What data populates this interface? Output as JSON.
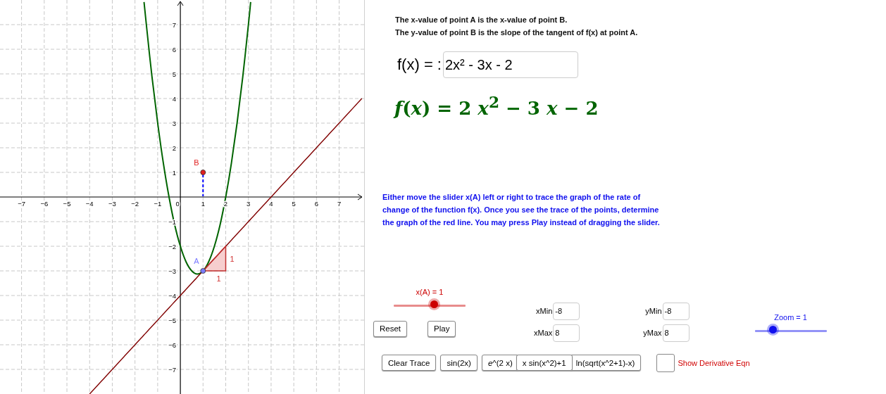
{
  "graph": {
    "chart_data": {
      "type": "line",
      "x": [
        -4,
        -3.75,
        -3.5,
        -3.25,
        -3,
        -2.75,
        -2.5,
        -2.25,
        -2,
        -1.75,
        -1.6,
        -1.5,
        -1.25,
        -1,
        -0.75,
        -0.5,
        -0.25,
        0,
        0.25,
        0.5,
        0.75,
        1,
        1.25,
        1.5,
        1.75,
        2,
        2.25,
        2.5,
        2.75,
        3,
        3.1,
        3.25,
        3.5,
        3.75,
        4,
        4.25,
        4.5,
        4.75,
        5,
        5.25,
        5.5,
        5.75,
        6,
        6.25,
        6.5,
        6.75,
        7,
        7.25,
        7.5,
        7.75,
        8
      ],
      "series": [
        {
          "color": "#006400",
          "values": [
            null,
            null,
            null,
            null,
            null,
            null,
            null,
            null,
            null,
            null,
            7.92,
            7,
            4.88,
            3,
            1.38,
            0,
            -1.13,
            -2,
            -2.63,
            -3,
            -3.13,
            -3,
            -2.63,
            -2,
            -1.13,
            0,
            1.38,
            3,
            4.88,
            7,
            7.92,
            null,
            null,
            null,
            null,
            null,
            null,
            null,
            null,
            null,
            null,
            null,
            null,
            null,
            null,
            null,
            null,
            null,
            null,
            null,
            null
          ]
        },
        {
          "color": "#800000",
          "values": [
            -8,
            -7.75,
            -7.5,
            -7.25,
            -7,
            -6.75,
            -6.5,
            -6.25,
            -6,
            -5.75,
            -5.6,
            -5.5,
            -5.25,
            -5,
            -4.75,
            -4.5,
            -4.25,
            -4,
            -3.75,
            -3.5,
            -3.25,
            -3,
            -2.75,
            -2.5,
            -2.25,
            -2,
            -1.75,
            -1.5,
            -1.25,
            -1,
            -0.9,
            -0.75,
            -0.5,
            -0.25,
            0,
            0.25,
            0.5,
            0.75,
            1,
            1.25,
            1.5,
            1.75,
            2,
            2.25,
            2.5,
            2.75,
            3,
            3.25,
            3.5,
            3.75,
            4
          ]
        }
      ],
      "grid": true,
      "xlim": [
        -7.95,
        8.1
      ],
      "ylim": [
        -8,
        8
      ],
      "xticks": [
        {
          "value": -7,
          "label": "−7"
        },
        {
          "value": -6,
          "label": "−6"
        },
        {
          "value": -5,
          "label": "−5"
        },
        {
          "value": -4,
          "label": "−4"
        },
        {
          "value": -3,
          "label": "−3"
        },
        {
          "value": -2,
          "label": "−2"
        },
        {
          "value": -1,
          "label": "−1"
        },
        0,
        1,
        2,
        3,
        4,
        5,
        6,
        7
      ],
      "yticks": [
        {
          "value": -7,
          "label": "−7"
        },
        {
          "value": -6,
          "label": "−6"
        },
        {
          "value": -5,
          "label": "−5"
        },
        {
          "value": -4,
          "label": "−4"
        },
        {
          "value": -3,
          "label": "−3"
        },
        {
          "value": -2,
          "label": "−2"
        },
        {
          "value": -1,
          "label": "−1"
        },
        1,
        2,
        3,
        4,
        5,
        6,
        7
      ]
    },
    "slope_triangle": {
      "run_label": "1",
      "rise_label": "1"
    },
    "points": [
      {
        "label": "B",
        "color": "#e02020"
      },
      {
        "label": "A",
        "color": "#7b7bff"
      }
    ]
  },
  "instructions": [
    "The x-value of point A is the x-value of point B.",
    "The y-value of point B is the slope of the tangent of f(x) at point A."
  ],
  "function_input": {
    "label": "f(x) = :",
    "value": "2x² - 3x - 2"
  },
  "formula": "*f*(*x*) = 2 *x*$^{2}$ − 3 *x* − 2",
  "hint": "Either move the slider x(A) left or right to trace the graph of the rate of change of the function f(x). Once you see the trace of the points, determine the graph of the red line. You may press Play instead of dragging the slider.",
  "slider_x": {
    "label": "x(A) = 1",
    "level": 0.57
  },
  "play_buttons": [
    "Reset",
    "Play"
  ],
  "range_fields": [
    {
      "label": "xMin",
      "value": "-8"
    },
    {
      "label": "xMax",
      "value": "8"
    },
    {
      "label": "yMin",
      "value": "-8"
    },
    {
      "label": "yMax",
      "value": "8"
    }
  ],
  "zoom_slider": {
    "label": "Zoom = 1",
    "level": 0.26
  },
  "function_buttons": [
    "Clear Trace",
    "sin(2x)",
    "*e*^(2 x)",
    "x sin(x^2)+1",
    "ln(sqrt(x^2+1)-x)"
  ],
  "derivative_checkbox": {
    "label": "Show Derivative Eqn",
    "checked": false
  }
}
